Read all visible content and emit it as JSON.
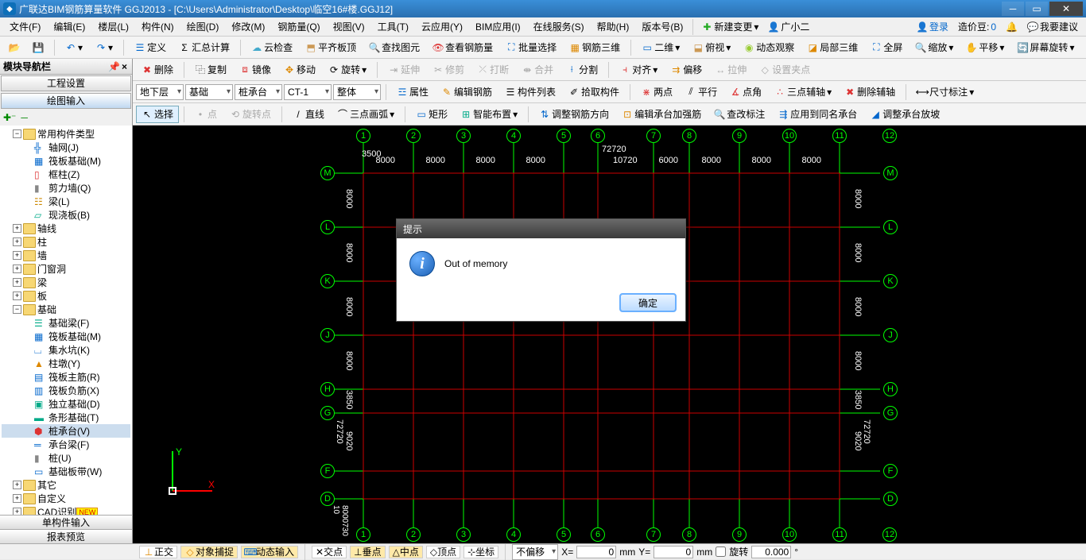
{
  "titlebar": {
    "app": "广联达BIM钢筋算量软件 GGJ2013 - [C:\\Users\\Administrator\\Desktop\\临空16#楼.GGJ12]"
  },
  "menubar": {
    "items": [
      "文件(F)",
      "编辑(E)",
      "楼层(L)",
      "构件(N)",
      "绘图(D)",
      "修改(M)",
      "钢筋量(Q)",
      "视图(V)",
      "工具(T)",
      "云应用(Y)",
      "BIM应用(I)",
      "在线服务(S)",
      "帮助(H)",
      "版本号(B)"
    ],
    "new_change": "新建变更",
    "right": {
      "agent": "广小二",
      "login": "登录",
      "coin_label": "造价豆:",
      "coin_value": "0",
      "feedback": "我要建议"
    }
  },
  "toolbar1": {
    "define": "定义",
    "calc": "汇总计算",
    "cloud": "云检查",
    "flat": "平齐板顶",
    "find": "查找图元",
    "view_rebar": "查看钢筋量",
    "batch": "批量选择",
    "rebar3d": "钢筋三维",
    "d2": "二维",
    "iso": "俯视",
    "dyn": "动态观察",
    "local3d": "局部三维",
    "full": "全屏",
    "zoom": "缩放",
    "pan": "平移",
    "screenrot": "屏幕旋转"
  },
  "toolbar2": {
    "delete": "删除",
    "copy": "复制",
    "mirror": "镜像",
    "move": "移动",
    "rotate": "旋转",
    "extend": "延伸",
    "trim": "修剪",
    "break": "打断",
    "merge": "合并",
    "split": "分割",
    "align": "对齐",
    "offset": "偏移",
    "stretch": "拉伸",
    "set_grip": "设置夹点"
  },
  "toolbar3": {
    "floor": "地下层",
    "category": "基础",
    "subtype": "桩承台",
    "code": "CT-1",
    "mode": "整体",
    "prop": "属性",
    "edit_rebar": "编辑钢筋",
    "list": "构件列表",
    "pick": "拾取构件",
    "two_pt": "两点",
    "parallel": "平行",
    "point_angle": "点角",
    "three_pt_aux": "三点辅轴",
    "del_aux": "删除辅轴",
    "dim": "尺寸标注"
  },
  "toolbar4": {
    "select": "选择",
    "point": "点",
    "rot_point": "旋转点",
    "line": "直线",
    "three_arc": "三点画弧",
    "rect": "矩形",
    "smart": "智能布置",
    "adjust_dir": "调整钢筋方向",
    "edit_cap_rebar": "编辑承台加强筋",
    "find_mark": "查改标注",
    "apply_same": "应用到同名承台",
    "adjust_slope": "调整承台放坡"
  },
  "nav": {
    "title": "模块导航栏",
    "tab1": "工程设置",
    "tab2": "绘图输入",
    "common": "常用构件类型",
    "axis": "轴网(J)",
    "raft": "筏板基础(M)",
    "frame": "框柱(Z)",
    "shear": "剪力墙(Q)",
    "beam": "梁(L)",
    "slab": "现浇板(B)",
    "g_axis": "轴线",
    "g_col": "柱",
    "g_wall": "墙",
    "g_opening": "门窗洞",
    "g_beam": "梁",
    "g_slab": "板",
    "g_found": "基础",
    "f_beam": "基础梁(F)",
    "f_raft": "筏板基础(M)",
    "f_sump": "集水坑(K)",
    "f_pier": "柱墩(Y)",
    "f_top": "筏板主筋(R)",
    "f_neg": "筏板负筋(X)",
    "f_iso": "独立基础(D)",
    "f_strip": "条形基础(T)",
    "f_cap": "桩承台(V)",
    "f_capbeam": "承台梁(F)",
    "f_pile": "桩(U)",
    "f_band": "基础板带(W)",
    "g_other": "其它",
    "g_custom": "自定义",
    "g_cad": "CAD识别",
    "bottom1": "单构件输入",
    "bottom2": "报表预览"
  },
  "dialog": {
    "title": "提示",
    "message": "Out of memory",
    "ok": "确定"
  },
  "status": {
    "ortho": "正交",
    "osnap": "对象捕捉",
    "dyninput": "动态输入",
    "cross": "交点",
    "perp": "垂点",
    "mid": "中点",
    "vert": "顶点",
    "coord": "坐标",
    "offset_mode": "不偏移",
    "x_label": "X=",
    "x": "0",
    "xu": "mm",
    "y_label": "Y=",
    "y": "0",
    "yu": "mm",
    "rot_label": "旋转",
    "rot": "0.000",
    "rot_u": "°"
  },
  "canvas": {
    "cols": [
      "1",
      "2",
      "3",
      "4",
      "5",
      "6",
      "7",
      "8",
      "9",
      "10",
      "11",
      "12"
    ],
    "col_dims": [
      "8000",
      "8000",
      "8000",
      "8000",
      "",
      "10720",
      "6000",
      "8000",
      "8000",
      "8000"
    ],
    "aux_top": {
      "left": "3500",
      "mid": "72720"
    },
    "rows": [
      "M",
      "L",
      "K",
      "J",
      "H",
      "G",
      "F",
      "D"
    ],
    "row_dims": [
      "8000",
      "8000",
      "8000",
      "8000",
      "3850",
      "9020",
      "",
      "8000"
    ],
    "aux_left": "72720",
    "bottom_aux": "8000730 10"
  }
}
